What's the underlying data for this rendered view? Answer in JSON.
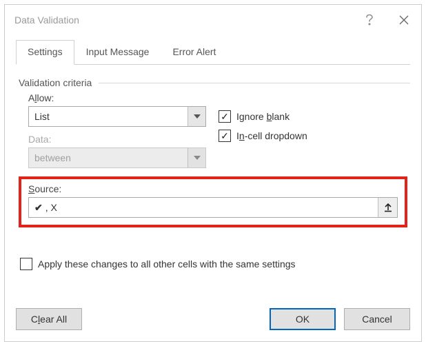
{
  "title": "Data Validation",
  "tabs": {
    "settings": "Settings",
    "inputMessage": "Input Message",
    "errorAlert": "Error Alert"
  },
  "criteria": {
    "heading": "Validation criteria",
    "allowLabelPre": "A",
    "allowLabelUl": "l",
    "allowLabelPost": "low:",
    "allowValue": "List",
    "dataLabel": "Data:",
    "dataValue": "between",
    "ignoreBlankPre": "Ignore ",
    "ignoreBlankUl": "b",
    "ignoreBlankPost": "lank",
    "inCellPre": "I",
    "inCellUl": "n",
    "inCellPost": "-cell dropdown",
    "sourceLabelUl": "S",
    "sourceLabelPost": "ource:",
    "sourceValueRest": ", X"
  },
  "applyLabelPre": "Apply these changes to all other cells with the same settings",
  "buttons": {
    "clearPre": "C",
    "clearUl": "l",
    "clearPost": "ear All",
    "ok": "OK",
    "cancel": "Cancel"
  }
}
